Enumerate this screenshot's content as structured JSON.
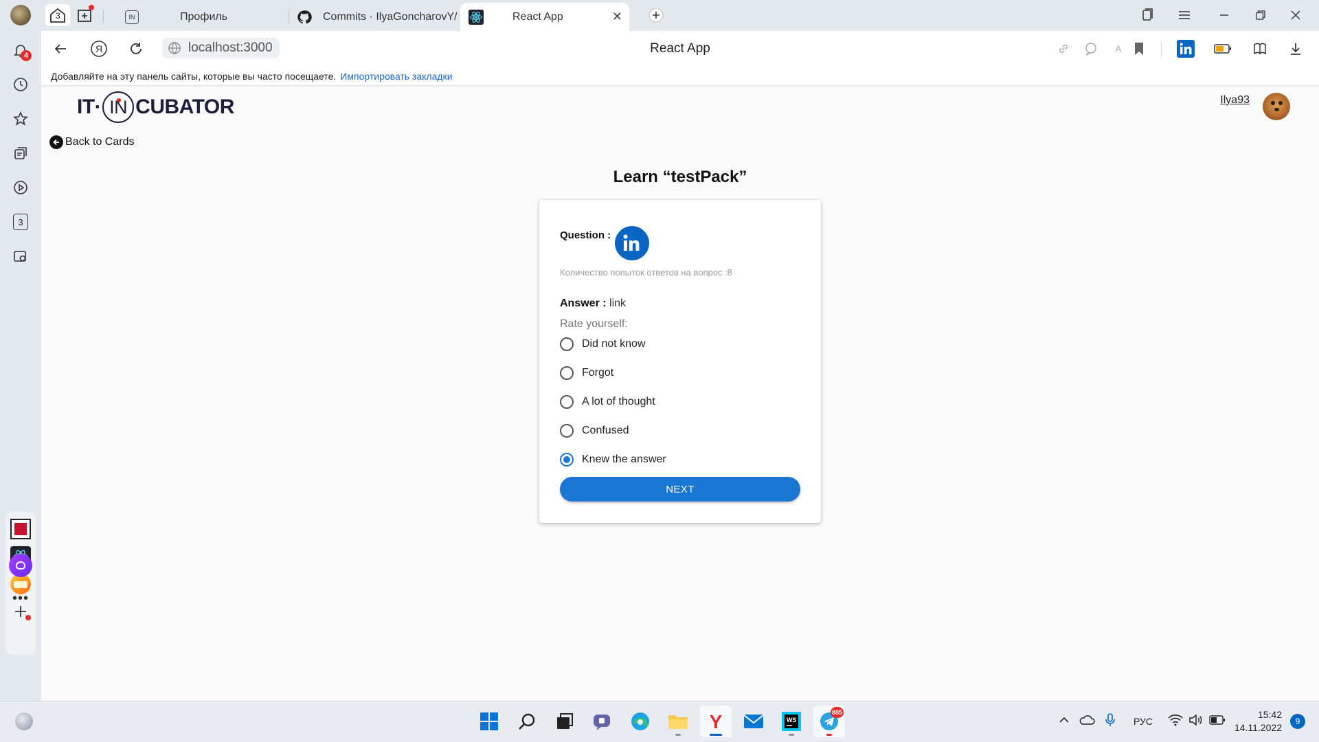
{
  "browser": {
    "tabs": [
      {
        "title": "Профиль",
        "active": false
      },
      {
        "title": "Commits · IlyaGoncharovY/",
        "active": false
      },
      {
        "title": "React App",
        "active": true
      }
    ],
    "home_badge": "3",
    "address": "localhost:3000",
    "page_title": "React App",
    "bookmarks_hint": "Добавляйте на эту панель сайты, которые вы часто посещаете.",
    "bookmarks_import": "Импортировать закладки"
  },
  "sidebar": {
    "notifications_count": "4",
    "collections_badge": "3"
  },
  "app": {
    "logo_left": "IT·",
    "logo_mid": "IN",
    "logo_right": "CUBATOR",
    "user_name": "Ilya93",
    "back_label": "Back to Cards",
    "learn_title": "Learn “testPack”",
    "question_label": "Question :",
    "question_image_icon": "linkedin-logo",
    "attempts_text": "Количество попыток ответов на вопрос :8",
    "answer_label": "Answer :",
    "answer_value": "link",
    "rate_label": "Rate yourself:",
    "options": [
      {
        "label": "Did not know",
        "checked": false
      },
      {
        "label": "Forgot",
        "checked": false
      },
      {
        "label": "A lot of thought",
        "checked": false
      },
      {
        "label": "Confused",
        "checked": false
      },
      {
        "label": "Knew the answer",
        "checked": true
      }
    ],
    "next_label": "NEXT",
    "accent_color": "#1976d2"
  },
  "taskbar": {
    "language": "РУС",
    "time": "15:42",
    "date": "14.11.2022",
    "notification_count": "9",
    "telegram_badge": "885"
  }
}
